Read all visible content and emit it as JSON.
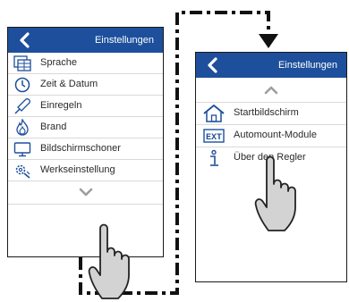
{
  "left_screen": {
    "title": "Einstellungen",
    "items": [
      {
        "label": "Sprache",
        "icon": "language-panel-icon"
      },
      {
        "label": "Zeit & Datum",
        "icon": "clock-icon"
      },
      {
        "label": "Einregeln",
        "icon": "probe-icon"
      },
      {
        "label": "Brand",
        "icon": "flame-icon"
      },
      {
        "label": "Bildschirmschoner",
        "icon": "monitor-icon"
      },
      {
        "label": "Werkseinstellung",
        "icon": "factory-settings-icon"
      }
    ],
    "scroll_icon": "chevron-down-icon"
  },
  "right_screen": {
    "title": "Einstellungen",
    "scroll_icon": "chevron-up-icon",
    "items": [
      {
        "label": "Startbildschirm",
        "icon": "home-icon"
      },
      {
        "label": "Automount-Module",
        "icon": "ext-icon",
        "icon_text": "EXT"
      },
      {
        "label": "Über den Regler",
        "icon": "info-icon"
      }
    ]
  },
  "colors": {
    "header_blue": "#1d4f9c",
    "icon_blue": "#1d4f9c",
    "chevron_gray": "#9e9e9e",
    "hand_fill": "#d3d3d3"
  }
}
